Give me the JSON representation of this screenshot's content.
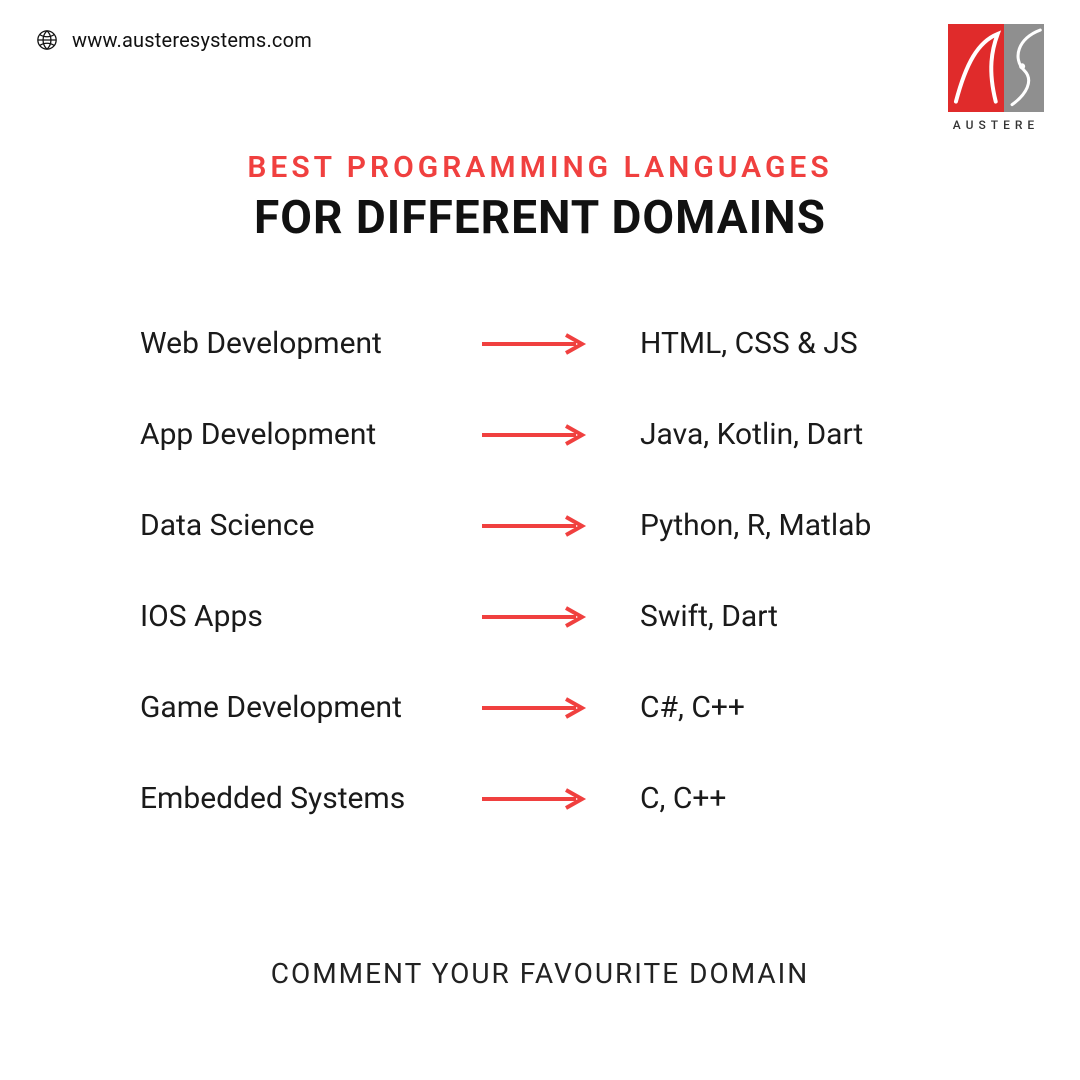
{
  "header": {
    "url": "www.austeresystems.com",
    "brand": "AUSTERE"
  },
  "title": {
    "line1": "BEST PROGRAMMING LANGUAGES",
    "line2": "FOR DIFFERENT DOMAINS"
  },
  "rows": [
    {
      "domain": "Web Development",
      "langs": "HTML, CSS & JS"
    },
    {
      "domain": "App Development",
      "langs": "Java, Kotlin, Dart"
    },
    {
      "domain": "Data Science",
      "langs": "Python, R, Matlab"
    },
    {
      "domain": "IOS Apps",
      "langs": "Swift, Dart"
    },
    {
      "domain": "Game Development",
      "langs": "C#, C++"
    },
    {
      "domain": "Embedded Systems",
      "langs": "C, C++"
    }
  ],
  "footer": "COMMENT YOUR FAVOURITE DOMAIN",
  "colors": {
    "accent": "#f0403f",
    "text": "#1a1a1a"
  }
}
